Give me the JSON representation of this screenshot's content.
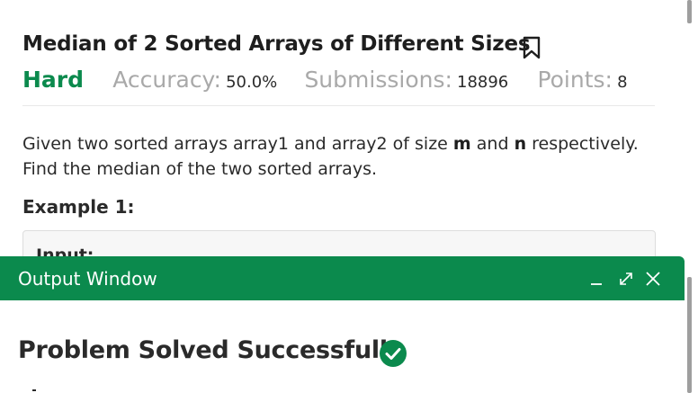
{
  "problem": {
    "title": "Median of 2 Sorted Arrays of Different Sizes",
    "difficulty": "Hard",
    "accuracy_label": "Accuracy:",
    "accuracy_value": "50.0%",
    "submissions_label": "Submissions:",
    "submissions_value": "18896",
    "points_label": "Points:",
    "points_value": "8",
    "statement_part1": "Given two sorted arrays array1 and array2 of size ",
    "statement_m": "m",
    "statement_and": " and ",
    "statement_n": "n",
    "statement_part2": " respectively. Find the median of the two sorted arrays.",
    "example_heading": "Example 1:",
    "example_input_label": "Input:"
  },
  "output_window": {
    "title": "Output Window",
    "result": "Problem Solved Successfully"
  },
  "colors": {
    "brand_green": "#0b8a4d",
    "muted_gray": "#a9a9a9"
  },
  "icons": [
    "bookmark-icon",
    "minimize-icon",
    "expand-icon",
    "close-icon",
    "check-circle-icon"
  ]
}
